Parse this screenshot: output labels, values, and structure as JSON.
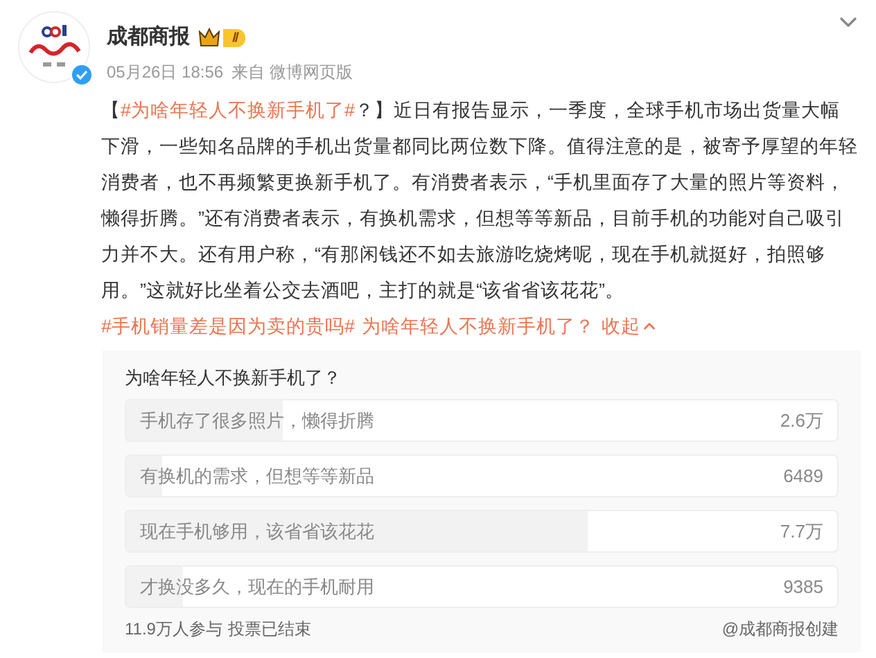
{
  "post": {
    "author": "成都商报",
    "level_badge": "Ⅱ",
    "verified": true,
    "time": "05月26日 18:56",
    "source": "来自 微博网页版",
    "segments": [
      {
        "kind": "text",
        "text": "【"
      },
      {
        "kind": "topic",
        "text": "#为啥年轻人不换新手机了#"
      },
      {
        "kind": "text",
        "text": "？】近日有报告显示，一季度，全球手机市场出货量大幅下滑，一些知名品牌的手机出货量都同比两位数下降。值得注意的是，被寄予厚望的年轻消费者，也不再频繁更换新手机了。有消费者表示，“手机里面存了大量的照片等资料，懒得折腾。”还有消费者表示，有换机需求，但想等等新品，目前手机的功能对自己吸引力并不大。还有用户称，“有那闲钱还不如去旅游吃烧烤呢，现在手机就挺好，拍照够用。”这就好比坐着公交去酒吧，主打的就是“该省省该花花”。"
      },
      {
        "kind": "topic",
        "text": "#手机销量差是因为卖的贵吗#"
      },
      {
        "kind": "topic",
        "text": "为啥年轻人不换新手机了？"
      },
      {
        "kind": "toggle",
        "text": "收起"
      }
    ]
  },
  "poll": {
    "question": "为啥年轻人不换新手机了？",
    "options": [
      {
        "label": "手机存了很多照片，懒得折腾",
        "count": "2.6万",
        "level": 0.22
      },
      {
        "label": "有换机的需求，但想等等新品",
        "count": "6489",
        "level": 0.05
      },
      {
        "label": "现在手机够用，该省省该花花",
        "count": "7.7万",
        "level": 0.65
      },
      {
        "label": "才换没多久，现在的手机耐用",
        "count": "9385",
        "level": 0.08
      }
    ],
    "participants": "11.9万人参与",
    "status": "投票已结束",
    "creator": "@成都商报创建"
  }
}
